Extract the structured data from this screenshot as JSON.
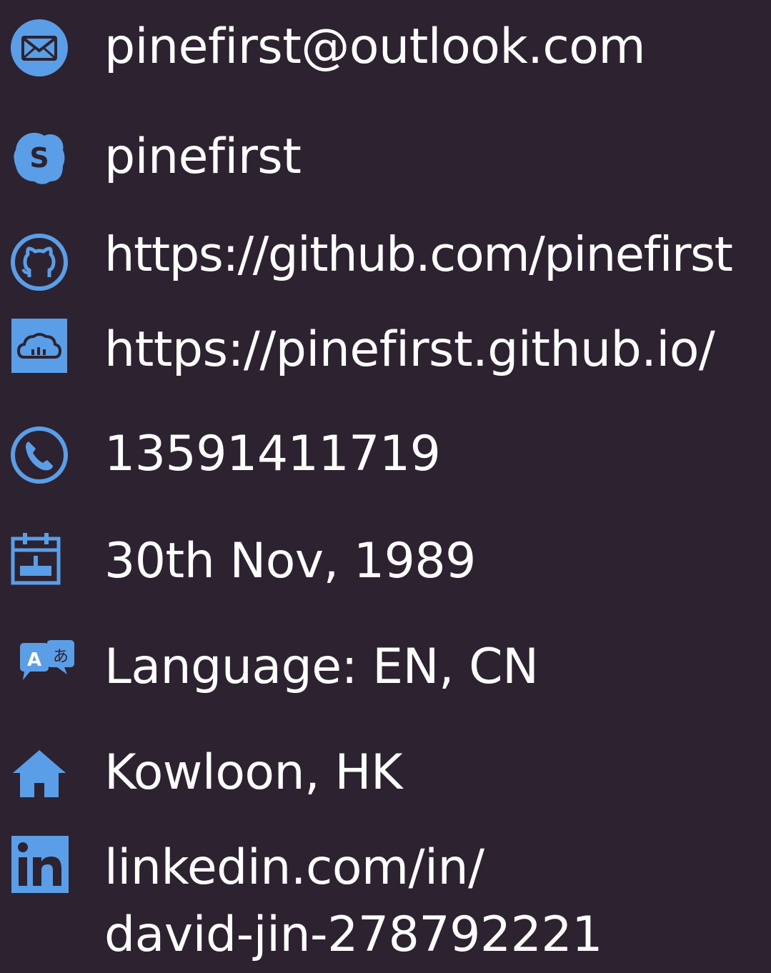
{
  "colors": {
    "background": "#2d2330",
    "icon_blue": "#5b9ee8",
    "text": "#ffffff"
  },
  "contacts": [
    {
      "icon": "email-icon",
      "text": "pinefirst@outlook.com"
    },
    {
      "icon": "skype-icon",
      "text": "pinefirst"
    },
    {
      "icon": "github-icon",
      "text": "https://github.com/pinefirst"
    },
    {
      "icon": "cloud-website-icon",
      "text": "https://pinefirst.github.io/"
    },
    {
      "icon": "phone-icon",
      "text": "13591411719"
    },
    {
      "icon": "calendar-icon",
      "text": "30th Nov, 1989"
    },
    {
      "icon": "translate-icon",
      "text": "Language: EN, CN"
    },
    {
      "icon": "home-icon",
      "text": "Kowloon, HK"
    },
    {
      "icon": "linkedin-icon",
      "text_line1": "linkedin.com/in/",
      "text_line2": "david-jin-278792221"
    }
  ]
}
